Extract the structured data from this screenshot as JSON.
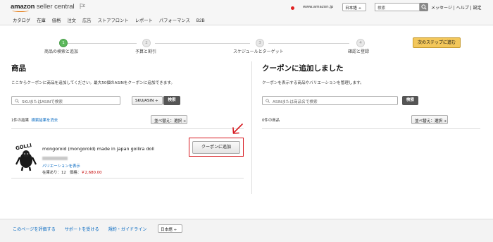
{
  "header": {
    "logo_amazon": "amazon",
    "logo_seller": "seller central",
    "domain": "www.amazon.jp",
    "language": "日本語",
    "search_placeholder": "検索",
    "links": "メッセージ | ヘルプ | 設定",
    "nav": [
      "カタログ",
      "在庫",
      "価格",
      "注文",
      "広告",
      "ストアフロント",
      "レポート",
      "パフォーマンス",
      "B2B"
    ]
  },
  "stepper": {
    "steps": [
      {
        "num": "1",
        "label": "商品の検索と追加"
      },
      {
        "num": "2",
        "label": "予算と割引"
      },
      {
        "num": "3",
        "label": "スケジュールとターゲット"
      },
      {
        "num": "4",
        "label": "確認と登録"
      }
    ],
    "next_button": "次のステップに進む"
  },
  "left": {
    "title": "商品",
    "description": "ここからクーポンに商品を追加してください。最大50個のASINをクーポンに追加できます。",
    "search_placeholder": "SKUまたはASINで検索",
    "search_type": "SKU/ASIN ÷",
    "search_button": "検索",
    "result_count": "1件の結果",
    "clear_link": "検索結果を消去",
    "sort_label": "並べ替え：選択 ÷",
    "product": {
      "title": "mongoroid (mongoroid) made in japan gollira doll",
      "variation_link": "バリエーションを表示",
      "stock": "在庫あり：12",
      "price_label": "価格：",
      "price": "￥2,680.00",
      "add_button": "クーポンに追加"
    }
  },
  "right": {
    "title": "クーポンに追加しました",
    "description": "クーポンを表示する商品やバリエーションを管理します。",
    "search_placeholder": "ASINまたは商品名で検索",
    "search_button": "検索",
    "count": "0件の商品",
    "sort_label": "並べ替え：選択 ÷"
  },
  "footer": {
    "links": [
      "このページを評価する",
      "サポートを受ける",
      "規約・ガイドライン"
    ],
    "language": "日本語 ÷"
  },
  "colors": {
    "accent_green": "#5cb85c",
    "next_button": "#f3c75b",
    "link": "#0066c0",
    "highlight_red": "#d71920",
    "price_red": "#c40000"
  }
}
